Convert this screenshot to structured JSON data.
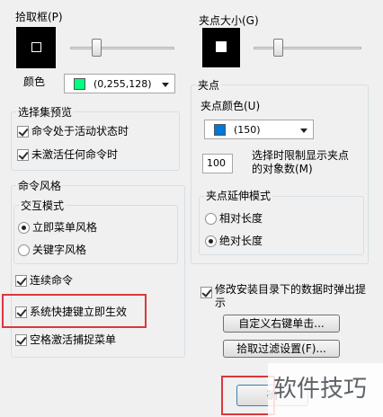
{
  "pickbox": {
    "title": "拾取框(P)",
    "color_label": "颜色",
    "color_value": "(0,255,128)",
    "swatch_color": "#00ff80"
  },
  "grip_size": {
    "title": "夹点大小(G)"
  },
  "grips": {
    "title": "夹点",
    "color_label": "夹点颜色(U)",
    "color_value": "(150)",
    "swatch_color": "#0078d7",
    "limit_value": "100",
    "limit_label_line1": "选择时限制显示夹点",
    "limit_label_line2": "的对象数(M)",
    "extend": {
      "title": "夹点延伸模式",
      "options": [
        {
          "label": "相对长度",
          "selected": false
        },
        {
          "label": "绝对长度",
          "selected": true
        }
      ]
    }
  },
  "selection_preview": {
    "title": "选择集预览",
    "options": [
      {
        "label": "命令处于活动状态时",
        "checked": true
      },
      {
        "label": "未激活任何命令时",
        "checked": true
      }
    ]
  },
  "command_style": {
    "title": "命令风格",
    "interaction": {
      "title": "交互模式",
      "options": [
        {
          "label": "立即菜单风格",
          "selected": true
        },
        {
          "label": "关键字风格",
          "selected": false
        }
      ]
    },
    "options": [
      {
        "label": "连续命令",
        "checked": true
      },
      {
        "label": "系统快捷键立即生效",
        "checked": true
      },
      {
        "label": "空格激活捕捉菜单",
        "checked": true
      }
    ]
  },
  "install_prompt": {
    "label_line1": "修改安装目录下的数据时弹出提",
    "label_line2": "示",
    "checked": true
  },
  "buttons": {
    "right_click": "自定义右键单击...",
    "pick_filter": "拾取过滤设置(F)...",
    "ok": "确"
  },
  "watermark": "软件技巧",
  "colors": {
    "highlight_red": "#d9383e",
    "panel_bg": "#f0f0f0"
  }
}
